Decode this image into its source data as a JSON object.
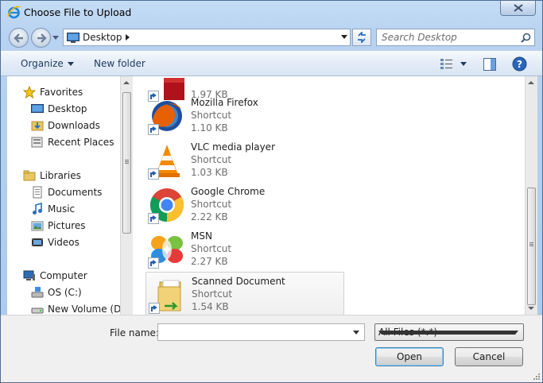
{
  "window": {
    "title": "Choose File to Upload"
  },
  "address": {
    "location": "Desktop"
  },
  "search": {
    "placeholder": "Search Desktop"
  },
  "toolbar": {
    "organize_label": "Organize",
    "new_folder_label": "New folder"
  },
  "nav": {
    "favorites": {
      "label": "Favorites",
      "items": [
        {
          "label": "Desktop"
        },
        {
          "label": "Downloads"
        },
        {
          "label": "Recent Places"
        }
      ]
    },
    "libraries": {
      "label": "Libraries",
      "items": [
        {
          "label": "Documents"
        },
        {
          "label": "Music"
        },
        {
          "label": "Pictures"
        },
        {
          "label": "Videos"
        }
      ]
    },
    "computer": {
      "label": "Computer",
      "items": [
        {
          "label": "OS (C:)"
        },
        {
          "label": "New Volume (D:)"
        }
      ]
    }
  },
  "files": [
    {
      "name": "",
      "type": "",
      "size": "1.97 KB",
      "icon": "red-app-icon"
    },
    {
      "name": "Mozilla Firefox",
      "type": "Shortcut",
      "size": "1.10 KB",
      "icon": "firefox-icon"
    },
    {
      "name": "VLC media player",
      "type": "Shortcut",
      "size": "1.03 KB",
      "icon": "vlc-icon"
    },
    {
      "name": "Google Chrome",
      "type": "Shortcut",
      "size": "2.22 KB",
      "icon": "chrome-icon"
    },
    {
      "name": "MSN",
      "type": "Shortcut",
      "size": "2.27 KB",
      "icon": "msn-icon"
    },
    {
      "name": "Scanned Document",
      "type": "Shortcut",
      "size": "1.54 KB",
      "icon": "folder-icon",
      "selected": true
    }
  ],
  "bottom": {
    "file_name_label": "File name:",
    "file_name_value": "",
    "file_type": "All Files (*.*)",
    "open_label": "Open",
    "cancel_label": "Cancel"
  },
  "colors": {
    "accent": "#3c7fb1",
    "frame": "#b8d3f1",
    "toolbar": "#e3ecf7"
  }
}
